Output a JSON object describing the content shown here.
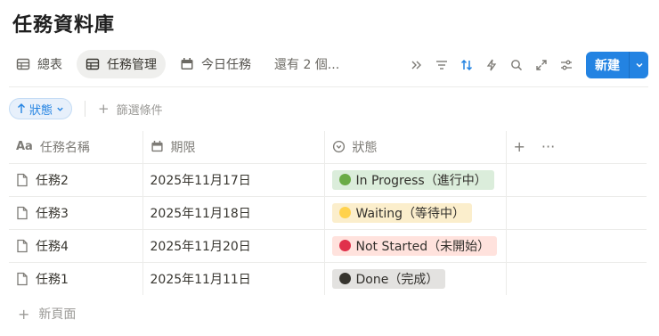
{
  "page": {
    "title": "任務資料庫"
  },
  "tabs": [
    {
      "label": "總表",
      "icon": "table-icon",
      "active": false
    },
    {
      "label": "任務管理",
      "icon": "table-icon",
      "active": true
    },
    {
      "label": "今日任務",
      "icon": "calendar-icon",
      "active": false
    }
  ],
  "more_views": "還有 2 個...",
  "toolbar": {
    "icons": [
      "double-chevron-right-icon",
      "filter-icon",
      "sort-icon",
      "lightning-icon",
      "search-icon",
      "expand-icon",
      "settings-sliders-icon"
    ],
    "new_label": "新建",
    "accent": "#2383e2"
  },
  "filter": {
    "sort_chip": "狀態",
    "add_filter": "篩選條件"
  },
  "table": {
    "headers": {
      "name": "任務名稱",
      "date": "期限",
      "status": "狀態"
    },
    "rows": [
      {
        "name": "任務2",
        "date": "2025年11月17日",
        "status": "In Progress（進行中）",
        "dot": "#6aab46",
        "bg": "#dbeddb"
      },
      {
        "name": "任務3",
        "date": "2025年11月18日",
        "status": "Waiting（等待中）",
        "dot": "#ffd24d",
        "bg": "#fbeecc"
      },
      {
        "name": "任務4",
        "date": "2025年11月20日",
        "status": "Not Started（未開始）",
        "dot": "#e0314b",
        "bg": "#ffe2dd"
      },
      {
        "name": "任務1",
        "date": "2025年11月11日",
        "status": "Done（完成）",
        "dot": "#37352f",
        "bg": "#e3e2e0"
      }
    ],
    "new_row": "新頁面",
    "header_actions": [
      "+",
      "···"
    ]
  }
}
